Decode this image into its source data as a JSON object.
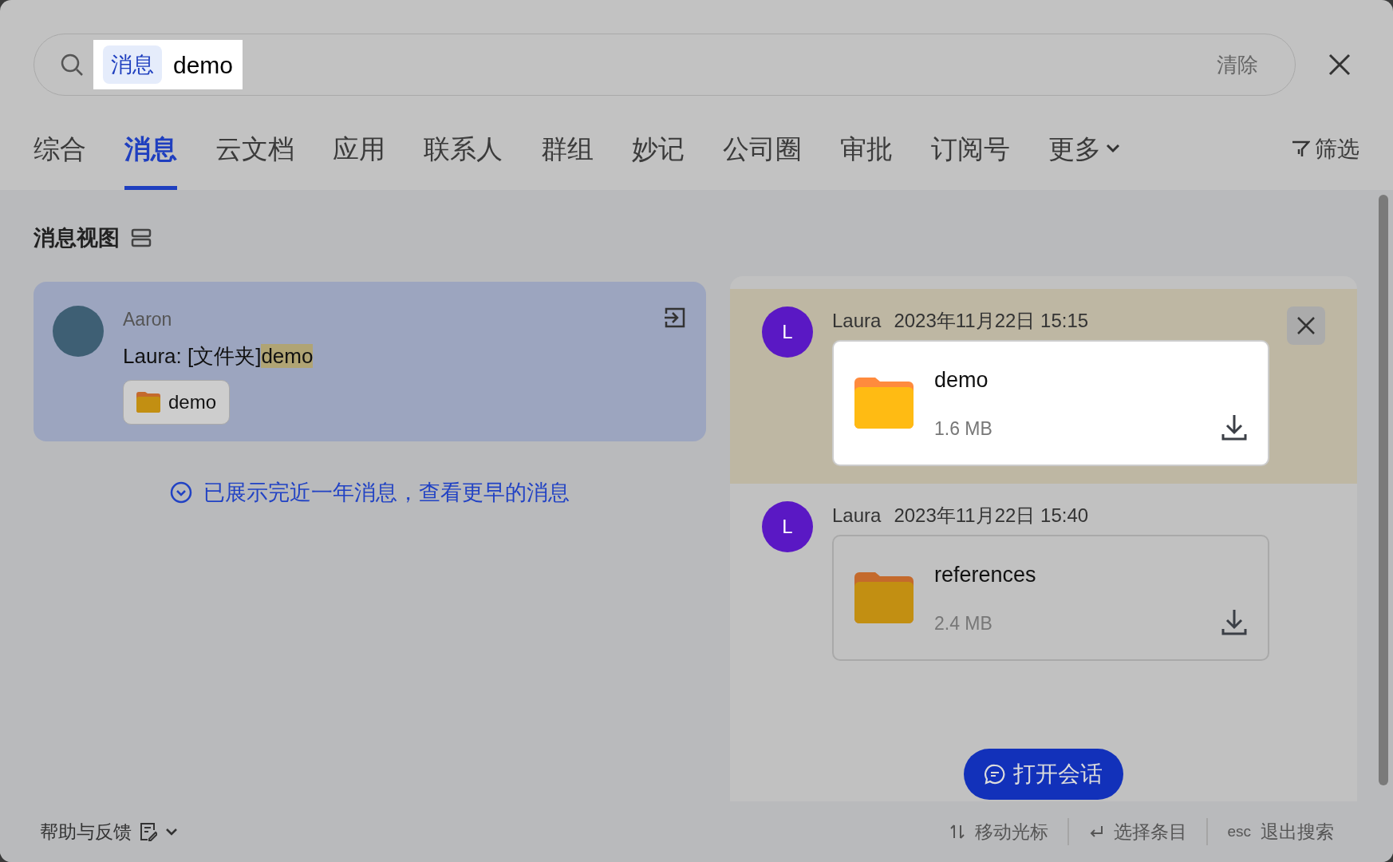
{
  "search": {
    "scope_tag": "消息",
    "query": "demo",
    "clear_label": "清除"
  },
  "tabs": [
    {
      "label": "综合",
      "selected": false
    },
    {
      "label": "消息",
      "selected": true
    },
    {
      "label": "云文档",
      "selected": false
    },
    {
      "label": "应用",
      "selected": false
    },
    {
      "label": "联系人",
      "selected": false
    },
    {
      "label": "群组",
      "selected": false
    },
    {
      "label": "妙记",
      "selected": false
    },
    {
      "label": "公司圈",
      "selected": false
    },
    {
      "label": "审批",
      "selected": false
    },
    {
      "label": "订阅号",
      "selected": false
    }
  ],
  "more_tab": "更多",
  "filter": "筛选",
  "section_title": "消息视图",
  "results": [
    {
      "chat": "Aaron",
      "preview_prefix": "Laura: [文件夹]",
      "match": "demo",
      "attachment": "demo",
      "selected": true
    }
  ],
  "load_more": "已展示完近一年消息，查看更早的消息",
  "messages": [
    {
      "avatar": "L",
      "sender": "Laura",
      "time": "2023年11月22日 15:15",
      "file_name": "demo",
      "file_size": "1.6 MB",
      "selected": true
    },
    {
      "avatar": "L",
      "sender": "Laura",
      "time": "2023年11月22日 15:40",
      "file_name": "references",
      "file_size": "2.4 MB",
      "selected": false
    }
  ],
  "open_chat_button": "打开会话",
  "footer": {
    "help": "帮助与反馈",
    "hints": [
      {
        "kind": "arrows",
        "label": "移动光标"
      },
      {
        "kind": "enter",
        "label": "选择条目"
      },
      {
        "kind": "key",
        "key": "esc",
        "label": "退出搜索"
      }
    ]
  }
}
